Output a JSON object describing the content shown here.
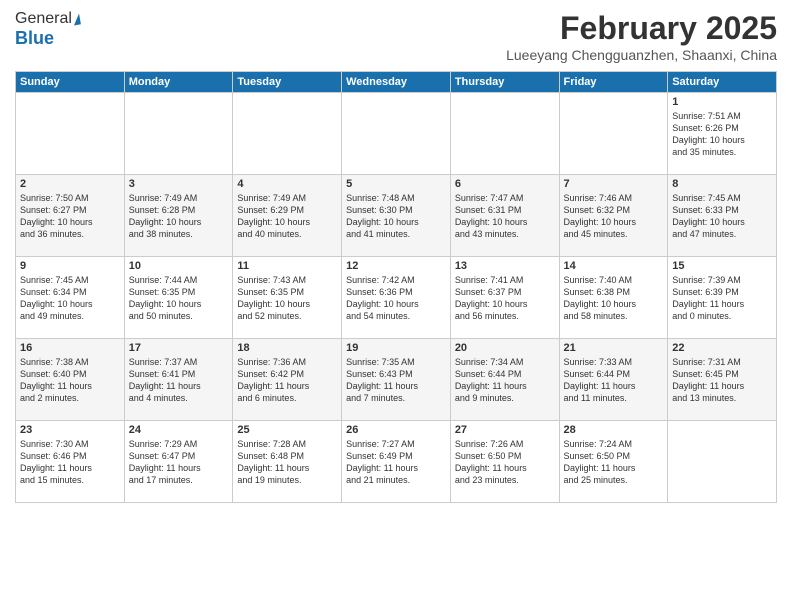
{
  "header": {
    "logo_general": "General",
    "logo_blue": "Blue",
    "month_title": "February 2025",
    "location": "Lueeyang Chengguanzhen, Shaanxi, China"
  },
  "days_of_week": [
    "Sunday",
    "Monday",
    "Tuesday",
    "Wednesday",
    "Thursday",
    "Friday",
    "Saturday"
  ],
  "weeks": [
    [
      {
        "day": "",
        "info": ""
      },
      {
        "day": "",
        "info": ""
      },
      {
        "day": "",
        "info": ""
      },
      {
        "day": "",
        "info": ""
      },
      {
        "day": "",
        "info": ""
      },
      {
        "day": "",
        "info": ""
      },
      {
        "day": "1",
        "info": "Sunrise: 7:51 AM\nSunset: 6:26 PM\nDaylight: 10 hours\nand 35 minutes."
      }
    ],
    [
      {
        "day": "2",
        "info": "Sunrise: 7:50 AM\nSunset: 6:27 PM\nDaylight: 10 hours\nand 36 minutes."
      },
      {
        "day": "3",
        "info": "Sunrise: 7:49 AM\nSunset: 6:28 PM\nDaylight: 10 hours\nand 38 minutes."
      },
      {
        "day": "4",
        "info": "Sunrise: 7:49 AM\nSunset: 6:29 PM\nDaylight: 10 hours\nand 40 minutes."
      },
      {
        "day": "5",
        "info": "Sunrise: 7:48 AM\nSunset: 6:30 PM\nDaylight: 10 hours\nand 41 minutes."
      },
      {
        "day": "6",
        "info": "Sunrise: 7:47 AM\nSunset: 6:31 PM\nDaylight: 10 hours\nand 43 minutes."
      },
      {
        "day": "7",
        "info": "Sunrise: 7:46 AM\nSunset: 6:32 PM\nDaylight: 10 hours\nand 45 minutes."
      },
      {
        "day": "8",
        "info": "Sunrise: 7:45 AM\nSunset: 6:33 PM\nDaylight: 10 hours\nand 47 minutes."
      }
    ],
    [
      {
        "day": "9",
        "info": "Sunrise: 7:45 AM\nSunset: 6:34 PM\nDaylight: 10 hours\nand 49 minutes."
      },
      {
        "day": "10",
        "info": "Sunrise: 7:44 AM\nSunset: 6:35 PM\nDaylight: 10 hours\nand 50 minutes."
      },
      {
        "day": "11",
        "info": "Sunrise: 7:43 AM\nSunset: 6:35 PM\nDaylight: 10 hours\nand 52 minutes."
      },
      {
        "day": "12",
        "info": "Sunrise: 7:42 AM\nSunset: 6:36 PM\nDaylight: 10 hours\nand 54 minutes."
      },
      {
        "day": "13",
        "info": "Sunrise: 7:41 AM\nSunset: 6:37 PM\nDaylight: 10 hours\nand 56 minutes."
      },
      {
        "day": "14",
        "info": "Sunrise: 7:40 AM\nSunset: 6:38 PM\nDaylight: 10 hours\nand 58 minutes."
      },
      {
        "day": "15",
        "info": "Sunrise: 7:39 AM\nSunset: 6:39 PM\nDaylight: 11 hours\nand 0 minutes."
      }
    ],
    [
      {
        "day": "16",
        "info": "Sunrise: 7:38 AM\nSunset: 6:40 PM\nDaylight: 11 hours\nand 2 minutes."
      },
      {
        "day": "17",
        "info": "Sunrise: 7:37 AM\nSunset: 6:41 PM\nDaylight: 11 hours\nand 4 minutes."
      },
      {
        "day": "18",
        "info": "Sunrise: 7:36 AM\nSunset: 6:42 PM\nDaylight: 11 hours\nand 6 minutes."
      },
      {
        "day": "19",
        "info": "Sunrise: 7:35 AM\nSunset: 6:43 PM\nDaylight: 11 hours\nand 7 minutes."
      },
      {
        "day": "20",
        "info": "Sunrise: 7:34 AM\nSunset: 6:44 PM\nDaylight: 11 hours\nand 9 minutes."
      },
      {
        "day": "21",
        "info": "Sunrise: 7:33 AM\nSunset: 6:44 PM\nDaylight: 11 hours\nand 11 minutes."
      },
      {
        "day": "22",
        "info": "Sunrise: 7:31 AM\nSunset: 6:45 PM\nDaylight: 11 hours\nand 13 minutes."
      }
    ],
    [
      {
        "day": "23",
        "info": "Sunrise: 7:30 AM\nSunset: 6:46 PM\nDaylight: 11 hours\nand 15 minutes."
      },
      {
        "day": "24",
        "info": "Sunrise: 7:29 AM\nSunset: 6:47 PM\nDaylight: 11 hours\nand 17 minutes."
      },
      {
        "day": "25",
        "info": "Sunrise: 7:28 AM\nSunset: 6:48 PM\nDaylight: 11 hours\nand 19 minutes."
      },
      {
        "day": "26",
        "info": "Sunrise: 7:27 AM\nSunset: 6:49 PM\nDaylight: 11 hours\nand 21 minutes."
      },
      {
        "day": "27",
        "info": "Sunrise: 7:26 AM\nSunset: 6:50 PM\nDaylight: 11 hours\nand 23 minutes."
      },
      {
        "day": "28",
        "info": "Sunrise: 7:24 AM\nSunset: 6:50 PM\nDaylight: 11 hours\nand 25 minutes."
      },
      {
        "day": "",
        "info": ""
      }
    ]
  ]
}
